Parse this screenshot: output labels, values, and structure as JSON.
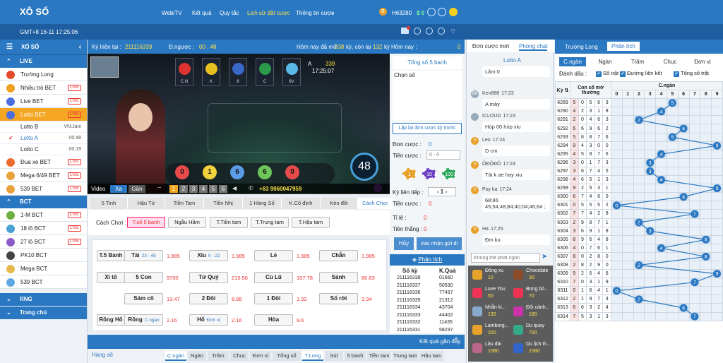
{
  "header": {
    "logo": "XÔ SỐ",
    "nav": [
      "Web/TV",
      "Kết quả",
      "Quy tắc",
      "Lịch sử đặt cược",
      "Thông tin cược"
    ],
    "active_nav": "Lịch sử đặt cược",
    "user_id": "H63280",
    "balance": "$ 0",
    "coin_icon": "B"
  },
  "subheader": {
    "gmt": "GMT+8 16-11 17:25:06"
  },
  "sidebar": {
    "title": "XỔ SỐ",
    "sections": {
      "live": "LIVE",
      "bct": "BCT",
      "rng": "RNG",
      "home": "Trang chủ"
    },
    "live_items": [
      {
        "label": "Trường Long",
        "color": "#e54b2b",
        "live": false
      },
      {
        "label": "Nhiều trò BET",
        "color": "#f0a020",
        "live": true
      },
      {
        "label": "Live BET",
        "color": "#4a6ee0",
        "live": true
      },
      {
        "label": "Lotto BET",
        "color": "#4a6ee0",
        "live": true
      }
    ],
    "lotto_subs": [
      {
        "label": "Lotto B",
        "time": "VN:Jani"
      },
      {
        "label": "Lotto A",
        "time": "00:48"
      },
      {
        "label": "Lotto C",
        "time": "00:19"
      }
    ],
    "live_items2": [
      {
        "label": "Đua xe BET",
        "color": "#ec6a2e",
        "live": true
      },
      {
        "label": "Mega 6/49 BET",
        "color": "#e9a13b",
        "live": true
      },
      {
        "label": "539 BET",
        "color": "#e9a13b",
        "live": true
      }
    ],
    "bct_items": [
      {
        "label": "1-M BCT",
        "color": "#6cae3f",
        "live": true
      },
      {
        "label": "18 lô BCT",
        "color": "#4aa1d6",
        "live": true
      },
      {
        "label": "27 lô BCT",
        "color": "#8c5ac9",
        "live": true
      },
      {
        "label": "PK10 BCT",
        "color": "#444",
        "live": false
      },
      {
        "label": "Mega BCT",
        "color": "#e7b84a",
        "live": false
      },
      {
        "label": "539 BCT",
        "color": "#5fa7e0",
        "live": false
      }
    ]
  },
  "infobar": {
    "ky_label": "Kỳ hiện tại :",
    "ky_value": "211116339",
    "countdown_label": "Đ.ngược :",
    "countdown": "00 : 48",
    "today_text": "Hôm nay đã mở",
    "today_open": "338",
    "today_mid": "kỳ, còn lại",
    "today_left": "132",
    "today_unit": "kỳ"
  },
  "video": {
    "balls_top": [
      {
        "name": "C.N",
        "color": "#d33"
      },
      {
        "name": "K",
        "color": "#e8c020"
      },
      {
        "name": "6",
        "color": "#3a68c8"
      },
      {
        "name": "C",
        "color": "#2b9a4a"
      },
      {
        "name": "8V",
        "color": "#5ab7e8"
      }
    ],
    "lotto_label": "A",
    "round": "339",
    "clock": "17:25:07",
    "balls": [
      "0",
      "1",
      "6",
      "6",
      "0"
    ],
    "ball_colors": [
      "#e64a4a",
      "#f0d23a",
      "#5b9be8",
      "#6cc65a",
      "#e64a4a"
    ],
    "big_number": "48",
    "video_label": "Video",
    "xa": "Xa",
    "gan": "Gần",
    "views": [
      "1",
      "2",
      "3",
      "4",
      "5",
      "6"
    ],
    "phone": "+63 9060047959"
  },
  "bet_tabs": [
    "5 Tinh",
    "Hậu Tứ",
    "Tiền Tam",
    "Tiền Nhị",
    "1 Hàng Số",
    "K.Cố định",
    "Kèo đôi",
    "Cách Chơi"
  ],
  "choices": {
    "label": "Cách Chơi :",
    "options": [
      "T.số 5 banh",
      "Ngẫu Hầm",
      "T.Tiền tam",
      "T.Trung tam",
      "T.Hậu tam"
    ]
  },
  "bets": [
    {
      "label": "T.5 Banh",
      "odds": ""
    },
    {
      "label": "Tài",
      "sub": "23 - 45",
      "odds": "1.985"
    },
    {
      "label": "Xỉu",
      "sub": "0 - 22",
      "odds": "1.985"
    },
    {
      "label": "Lẻ",
      "odds": "1.985"
    },
    {
      "label": "Chẵn",
      "odds": "1.985"
    },
    {
      "label": "Xì tố",
      "odds": ""
    },
    {
      "label": "5 Con",
      "odds": "9700"
    },
    {
      "label": "Tứ Quý",
      "odds": "215.56"
    },
    {
      "label": "Cù Lũ",
      "odds": "107.78"
    },
    {
      "label": "Sảnh",
      "odds": "80.83"
    },
    {
      "label": "Sám cô",
      "odds": "13.47"
    },
    {
      "label": "2 Đôi",
      "odds": "8.98"
    },
    {
      "label": "1 Đôi",
      "odds": "1.92"
    },
    {
      "label": "Số rời",
      "odds": "3.34"
    },
    {
      "label": "Rồng Hổ",
      "odds": ""
    },
    {
      "label": "Rồng",
      "sub": "C.ngàn",
      "odds": "2.16"
    },
    {
      "label": "Hổ",
      "sub": "Đơn vị",
      "odds": "2.16"
    },
    {
      "label": "Hòa",
      "odds": "9.6"
    }
  ],
  "right_mid": {
    "today_label": "Hôm nay :",
    "today_value": "0",
    "total_title": "Tổng số 5 banh",
    "choose": "Chọn số",
    "repeat": "Lặp lại đơn cược kỳ trước",
    "don_cuoc": "Đơn cược :",
    "don_value": "0",
    "tien_cuoc": "Tiền cược :",
    "tien_placeholder": "0 - 0",
    "chips": [
      "1",
      "10",
      "100"
    ],
    "ky_tiep": "Kỳ liên tiếp :",
    "ky_value": "1",
    "tien_cuoc2": "Tiền cược :",
    "tien_cuoc2_val": "0",
    "ti_le": "Tỉ    lệ :",
    "ti_le_val": "0",
    "tien_thang": "Tiền thắng :",
    "tien_thang_val": "0",
    "cancel": "Hủy",
    "submit": "Xác nhận gửi đi",
    "phan_tich": "Phân tích",
    "col_ky": "Số kỳ",
    "col_kq": "K.Quả",
    "results": [
      [
        "211116338",
        "01660"
      ],
      [
        "211116337",
        "50530"
      ],
      [
        "211116336",
        "77437"
      ],
      [
        "211116335",
        "21312"
      ],
      [
        "211116334",
        "43704"
      ],
      [
        "211116333",
        "44402"
      ],
      [
        "211116332",
        "11435"
      ],
      [
        "211116331",
        "58237"
      ]
    ]
  },
  "recent": {
    "label": "Kết quả gần đây"
  },
  "bottom_tabs": {
    "hang_so": "Hàng số",
    "tabs": [
      "C.ngàn",
      "Ngàn",
      "Trăm",
      "Chục",
      "Đơn vị",
      "Tổng số",
      "T.Long",
      "Sút",
      "5 banh",
      "Tiền tam",
      "Trung tam",
      "Hậu tam"
    ]
  },
  "chat": {
    "tabs": [
      "Đơn cược mới",
      "Phòng chat"
    ],
    "room": "Lotto A",
    "messages": [
      {
        "name": "",
        "time": "",
        "text": "Lâm 0",
        "av": ""
      },
      {
        "name": "Ken888",
        "time": "17:23",
        "text": "A mày",
        "av": "BK"
      },
      {
        "name": "ICLOUD",
        "time": "17:23",
        "text": "Húp 00 húp xỉu",
        "av": ""
      },
      {
        "name": "Leo",
        "time": "17:24",
        "text": "D cm",
        "av": "V"
      },
      {
        "name": "ÔĐÔĐÔ",
        "time": "17:24",
        "text": "Tài k ae hay xiu",
        "av": "V"
      },
      {
        "name": "Poy ka",
        "time": "17:24",
        "text": "68;86 45;54;48;84;40;04;46;64 ;",
        "av": "V"
      },
      {
        "name": "Ha",
        "time": "17:25",
        "text": "Đm ku",
        "av": "V"
      }
    ],
    "placeholder": "Không thể phát ngôn",
    "gifts": [
      {
        "label": "Đồng xu",
        "val": "10",
        "color": "#e6a22b"
      },
      {
        "label": "Chocolate",
        "val": "30",
        "color": "#8a4b2b"
      },
      {
        "label": "Love You",
        "val": "50",
        "color": "#e35"
      },
      {
        "label": "Bong bó...",
        "val": "70",
        "color": "#e35"
      },
      {
        "label": "Nhẫn ki...",
        "val": "130",
        "color": "#8ac"
      },
      {
        "label": "Đôi cánh...",
        "val": "180",
        "color": "#c3a"
      },
      {
        "label": "Lamborg...",
        "val": "200",
        "color": "#e6a22b"
      },
      {
        "label": "Du quay",
        "val": "700",
        "color": "#3a8"
      },
      {
        "label": "Lâu đài",
        "val": "1080",
        "color": "#b68"
      },
      {
        "label": "Du lịch th...",
        "val": "1580",
        "color": "#36c"
      }
    ]
  },
  "stats": {
    "tabs": [
      "Trường Long",
      "Phân tích"
    ],
    "subtabs": [
      "C.ngàn",
      "Ngàn",
      "Trăm",
      "Chục",
      "Đơn vị"
    ],
    "mark_label": "Đánh dấu :",
    "checks": [
      "Số trật",
      "Đường liên kết",
      "Tổng số trật"
    ],
    "col_ky": "Kỳ",
    "col_con": "Con số mở thưởng",
    "col_cngan": "C.ngàn",
    "digits": [
      "0",
      "1",
      "2",
      "3",
      "4",
      "5",
      "6",
      "7",
      "8",
      "9"
    ],
    "rows": [
      [
        "6289",
        "50563",
        "5"
      ],
      [
        "6290",
        "42318",
        "4"
      ],
      [
        "6291",
        "20463",
        "2"
      ],
      [
        "6292",
        "66962",
        "6"
      ],
      [
        "6293",
        "58876",
        "5"
      ],
      [
        "6294",
        "94300",
        "9"
      ],
      [
        "6295",
        "45876",
        "4"
      ],
      [
        "6296",
        "30173",
        "3"
      ],
      [
        "6297",
        "36745",
        "3"
      ],
      [
        "6298",
        "46513",
        "4"
      ],
      [
        "6299",
        "92531",
        "9"
      ],
      [
        "6300",
        "67460",
        "6"
      ],
      [
        "6301",
        "05552",
        "0"
      ],
      [
        "6302",
        "77428",
        "7"
      ],
      [
        "6303",
        "29871",
        "2"
      ],
      [
        "6304",
        "36918",
        "3"
      ],
      [
        "6305",
        "89648",
        "8"
      ],
      [
        "6306",
        "40761",
        "4"
      ],
      [
        "6307",
        "80280",
        "8"
      ],
      [
        "6308",
        "28290",
        "2"
      ],
      [
        "6309",
        "92646",
        "9"
      ],
      [
        "6310",
        "70319",
        "7"
      ],
      [
        "6311",
        "01641",
        "0"
      ],
      [
        "6312",
        "21974",
        "2"
      ],
      [
        "6313",
        "66324",
        "6"
      ],
      [
        "6314",
        "75313",
        "7"
      ]
    ]
  }
}
